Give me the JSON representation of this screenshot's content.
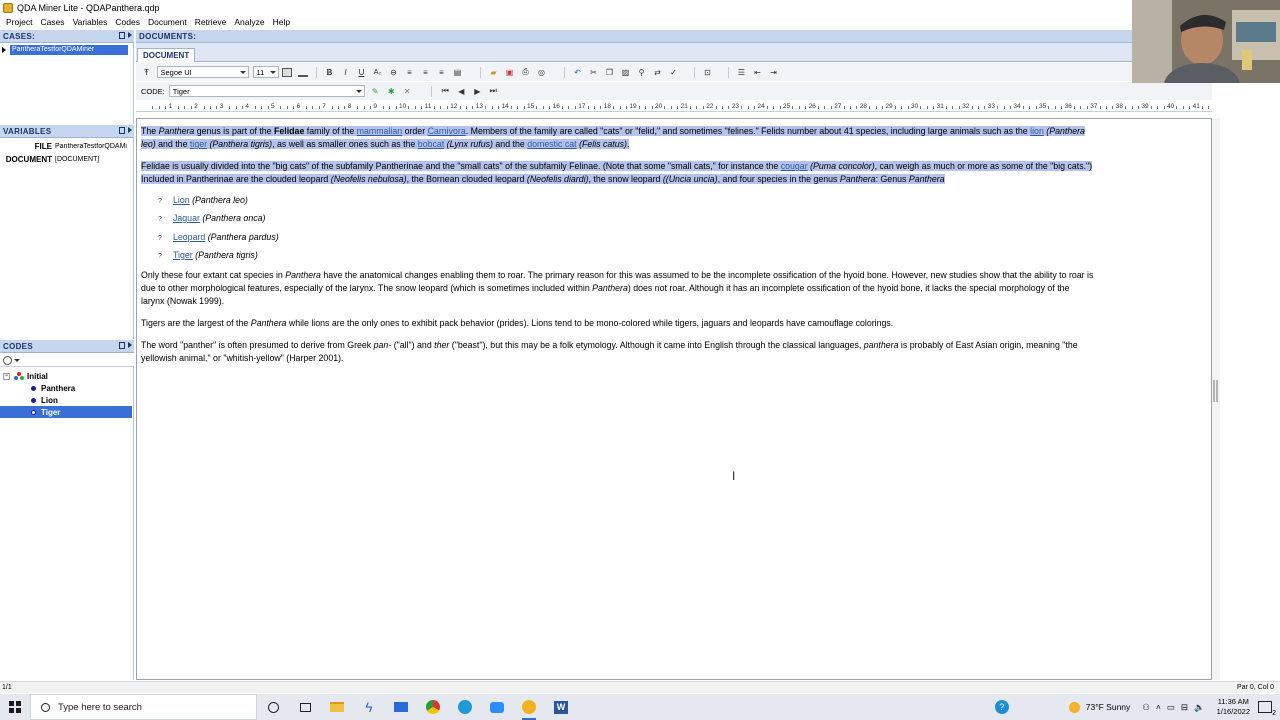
{
  "window": {
    "title": "QDA Miner Lite - QDAPanthera.qdp"
  },
  "menu": [
    "Project",
    "Cases",
    "Variables",
    "Codes",
    "Document",
    "Retrieve",
    "Analyze",
    "Help"
  ],
  "cases": {
    "header": "CASES:",
    "items": [
      {
        "label": "PantheraTestforQDAMiner"
      }
    ]
  },
  "documents": {
    "header": "DOCUMENTS:",
    "tab": "DOCUMENT"
  },
  "variables": {
    "header": "VARIABLES",
    "rows": [
      {
        "key": "FILE",
        "value": "PantheraTestforQDAMi"
      },
      {
        "key": "DOCUMENT",
        "value": "[DOCUMENT]"
      }
    ]
  },
  "codes": {
    "header": "CODES",
    "tree": [
      {
        "label": "Initial",
        "type": "group"
      },
      {
        "label": "Panthera",
        "type": "code"
      },
      {
        "label": "Lion",
        "type": "code"
      },
      {
        "label": "Tiger",
        "type": "code",
        "selected": true
      }
    ]
  },
  "format_toolbar": {
    "font": "Segoe UI",
    "size": "11"
  },
  "code_toolbar": {
    "label": "CODE:",
    "value": "Tiger"
  },
  "ruler": [
    "1",
    "2",
    "3",
    "4",
    "5",
    "6",
    "7",
    "8",
    "9",
    "10",
    "11",
    "12",
    "13",
    "14",
    "15",
    "16",
    "17",
    "18",
    "19",
    "20",
    "21",
    "22",
    "23",
    "24",
    "25",
    "26",
    "27",
    "28",
    "29",
    "30",
    "31",
    "32",
    "33",
    "34",
    "35",
    "36",
    "37",
    "38",
    "39",
    "40",
    "41",
    "42"
  ],
  "document": {
    "p1": {
      "t1": "The ",
      "panthera": "Panthera",
      "t2": " genus is part of the ",
      "felidae": "Felidae",
      "t3": " family of the ",
      "mammalian": "mammalian",
      "t4": " order ",
      "carnivora": "Carnivora",
      "t5": ". Members of the family are called \"cats\" or \"felid,\" and sometimes \"felines.\" Felids number about 41 species, including large animals such as the ",
      "lion": "lion",
      "t6": " ",
      "pleo": "(Panthera",
      "l2_pleo": "leo)",
      "t7": " and the ",
      "tiger": "tiger",
      "t8": " ",
      "ptigris": "(Panthera tigris)",
      "t9": ", as well as smaller ones such as the ",
      "bobcat": "bobcat",
      "t10": " ",
      "lynx": "(Lynx rufus)",
      "t11": " and the ",
      "domcat": "domestic cat",
      "t12": " ",
      "felis": "(Felis catus)",
      "t13": "."
    },
    "p2": {
      "t1": "Felidae is usually divided into the \"big cats\" of the subfamily Pantherinae and the \"small cats\" of the subfamily Felinae. (Note that some \"small cats,\" for instance the ",
      "cougar": "cougar",
      "t2": " ",
      "puma": "(Puma concolor)",
      "t3": ", can weigh as much or more as some of the \"big cats.\")",
      "l2_t1": "Included in Pantherinae are the clouded leopard ",
      "neb": "(Neofelis nebulosa)",
      "l2_t2": ", the Bornean clouded leopard ",
      "diardi": "(Neofelis diardi)",
      "l2_t3": ", the snow leopard ",
      "uncia": "((Uncia uncia)",
      "l2_t4": ", and four species in the genus ",
      "panthera": "Panthera",
      "l2_t5": ": Genus ",
      "panthera2": "Panthera"
    },
    "bullets": [
      {
        "marker": "?",
        "name": "Lion",
        "latin": "(Panthera leo)"
      },
      {
        "marker": "?",
        "name": "Jaguar",
        "latin": "(Panthera onca)"
      },
      {
        "marker": "?",
        "name": "Leopard",
        "latin": "(Panthera pardus)"
      },
      {
        "marker": "?",
        "name": "Tiger",
        "latin": "(Panthera tigris)"
      }
    ],
    "p3": {
      "t1": "Only these four extant cat species in ",
      "panthera": "Panthera",
      "t2": " have the anatomical changes enabling them to roar. The primary reason for this was assumed to be the incomplete ossification of the hyoid bone. However, new studies show that the ability to roar is",
      "l2_t1": "due to other morphological features, especially of the larynx. The snow leopard (which is sometimes included within ",
      "panthera2": "Panthera",
      "l2_t2": ") does not roar. Although it has an incomplete ossification of the hyoid bone, it lacks the special morphology of the",
      "l3": "larynx (Nowak 1999)."
    },
    "p4": {
      "t1": "Tigers are the largest of the ",
      "panthera": "Panthera",
      "t2": " while lions are the only ones to exhibit pack behavior (prides).  Lions tend to be mono-colored while tigers, jaguars and leopards have camouflage colorings."
    },
    "p5": {
      "t1": "The word \"panther\" is often presumed to derive from Greek ",
      "pan": "pan-",
      "t2": " (\"all\") and ",
      "ther": "ther",
      "t3": " (\"beast\"), but this may be a folk etymology. Although it came into English through the classical languages, ",
      "panthera": "panthera",
      "t4": " is probably of East Asian origin, meaning \"the",
      "l2": "yellowish animal,\" or \"whitish-yellow\" (Harper 2001)."
    }
  },
  "status": {
    "left": "1/1",
    "right": "Par 0, Col 0"
  },
  "taskbar": {
    "search_placeholder": "Type here to search",
    "weather": "73°F  Sunny",
    "time": "11:36 AM",
    "date": "1/16/2022",
    "notification_count": "2"
  },
  "colors": {
    "selection": "#3a6fd8",
    "highlight": "#b4c2ec",
    "panel_header": "#c6d6ef",
    "link": "#2c5aa0"
  }
}
